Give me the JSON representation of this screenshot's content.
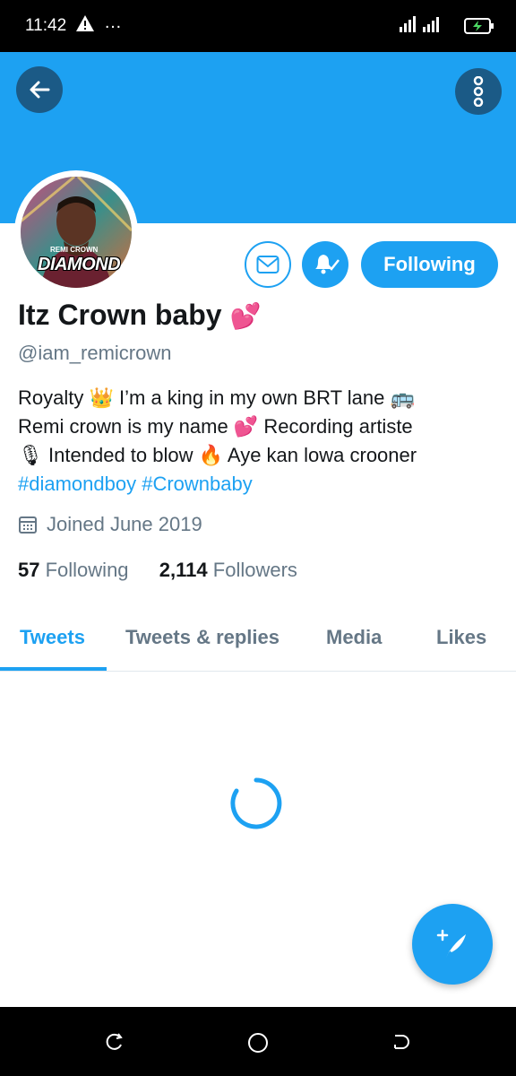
{
  "status_bar": {
    "time": "11:42",
    "dots": "…"
  },
  "profile": {
    "name": "Itz Crown baby",
    "name_emoji": "💕",
    "handle": "@iam_remicrown",
    "avatar_text": "DIAMOND",
    "avatar_top_text": "REMI CROWN",
    "bio": {
      "line1_a": "Royalty ",
      "line1_crown": "👑",
      "line1_b": " I’m a king in my own BRT lane ",
      "line1_bus": "🚌",
      "line2_a": "Remi crown is my name ",
      "line2_heart": "💕",
      "line2_b": " Recording artiste",
      "line3_mic": "🎙",
      "line3_a": " Intended to blow ",
      "line3_fire": "🔥",
      "line3_b": " Aye kan lowa crooner",
      "hashtag1": "#diamondboy",
      "hashtag2": "#Crownbaby"
    },
    "joined": "Joined June 2019",
    "following_count": "57",
    "following_label": "Following",
    "followers_count": "2,114",
    "followers_label": "Followers",
    "follow_button": "Following"
  },
  "tabs": [
    {
      "label": "Tweets",
      "active": true
    },
    {
      "label": "Tweets & replies",
      "active": false
    },
    {
      "label": "Media",
      "active": false
    },
    {
      "label": "Likes",
      "active": false
    }
  ],
  "colors": {
    "accent": "#1da1f2",
    "dark_button": "#1b5a86",
    "muted": "#657786"
  },
  "icons": [
    "back-arrow-icon",
    "more-vertical-icon",
    "mail-icon",
    "bell-icon",
    "calendar-icon",
    "compose-icon",
    "loading-spinner"
  ]
}
